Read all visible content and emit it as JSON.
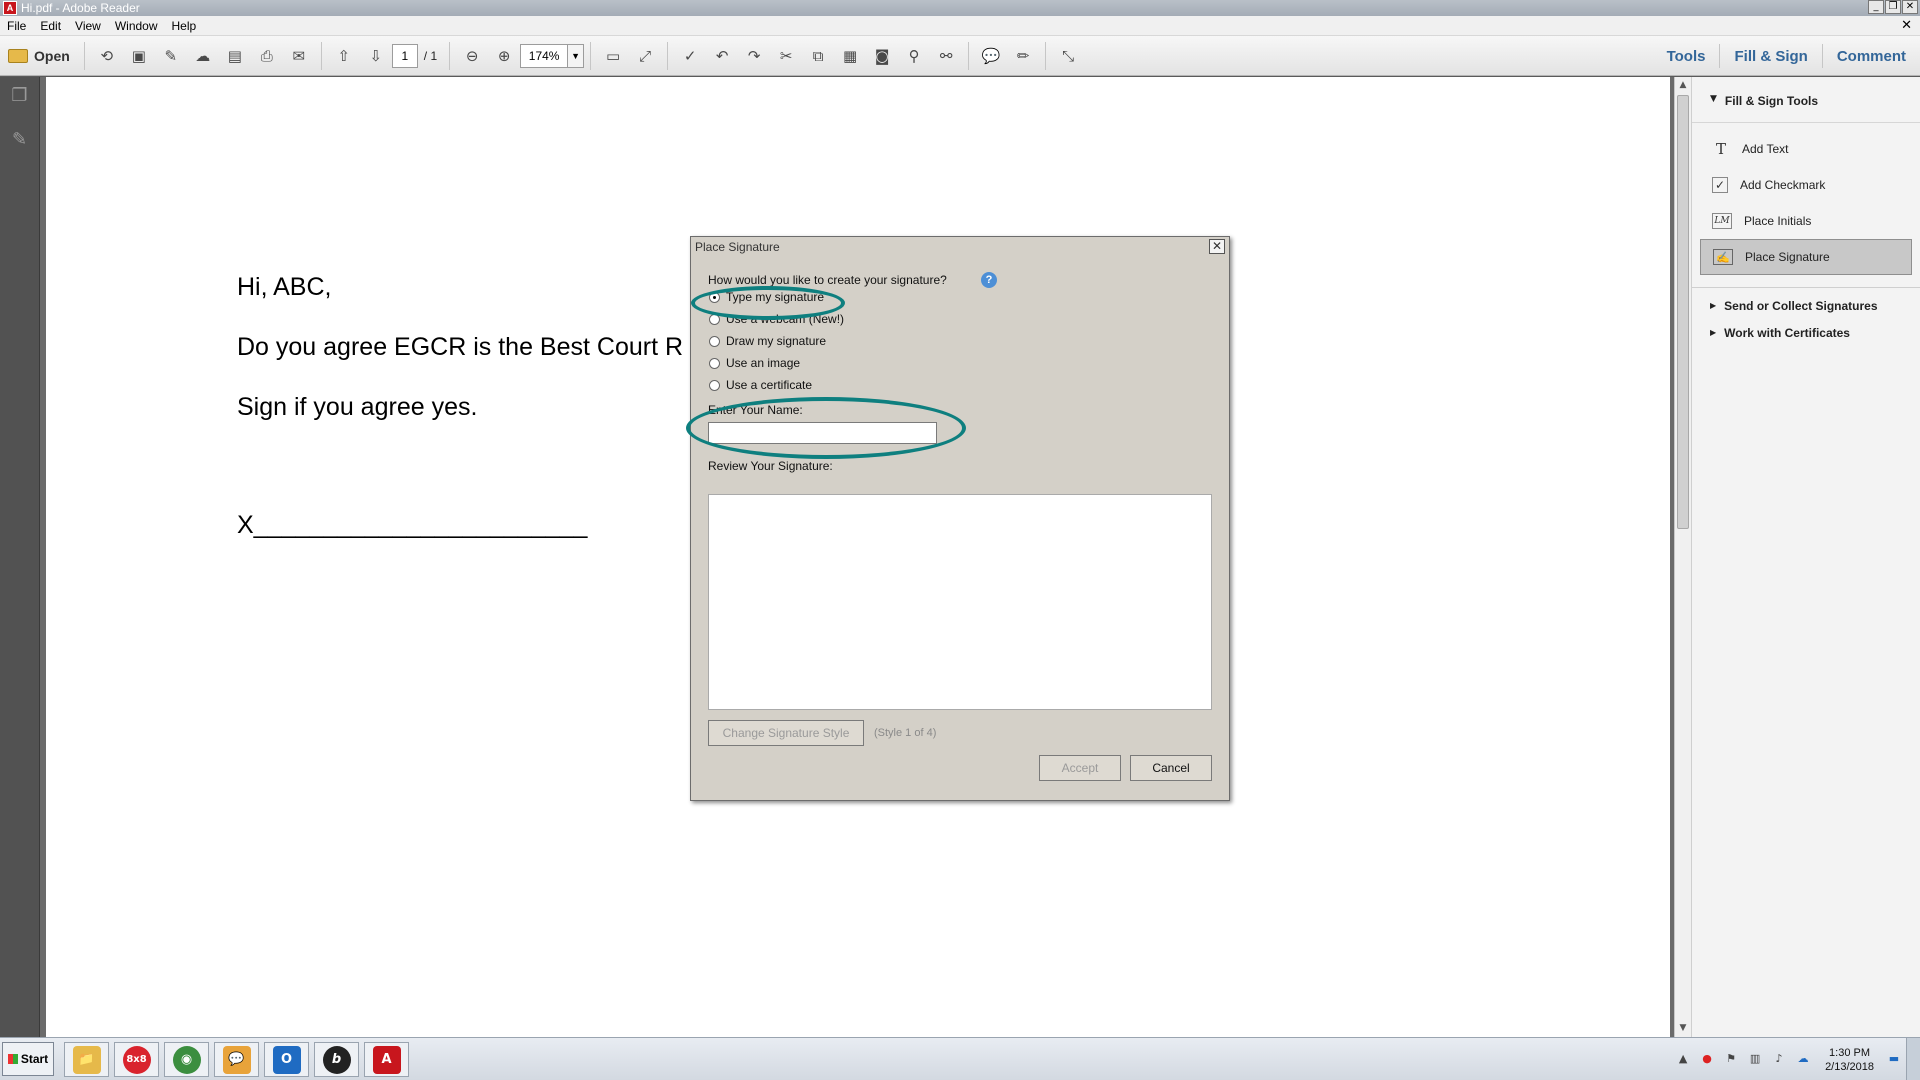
{
  "window": {
    "title": "Hi.pdf - Adobe Reader",
    "app_icon_text": "A",
    "controls": {
      "minimize": "_",
      "restore": "❐",
      "close": "✕"
    },
    "doc_close": "✕"
  },
  "menu": [
    "File",
    "Edit",
    "View",
    "Window",
    "Help"
  ],
  "toolbar": {
    "open_label": "Open",
    "page_current": "1",
    "page_total": "/ 1",
    "zoom": "174%",
    "zoom_dropdown": "▼",
    "tabs": [
      "Tools",
      "Fill & Sign",
      "Comment"
    ],
    "accent_color": "#336699"
  },
  "document": {
    "lines": [
      "Hi, ABC,",
      "Do you agree EGCR is the Best Court R",
      "Sign if you agree yes.",
      "X________________________"
    ]
  },
  "right_panel": {
    "header": "Fill & Sign Tools",
    "header_arrow": "▼",
    "items": [
      {
        "label": "Add Text",
        "icon": "T"
      },
      {
        "label": "Add Checkmark",
        "icon": "✓"
      },
      {
        "label": "Place Initials",
        "icon": "LM"
      },
      {
        "label": "Place Signature",
        "icon": "✍",
        "selected": true
      }
    ],
    "sections": [
      {
        "label": "Send or Collect Signatures",
        "arrow": "▶"
      },
      {
        "label": "Work with Certificates",
        "arrow": "▶"
      }
    ]
  },
  "dialog": {
    "title": "Place Signature",
    "close": "✕",
    "question": "How would you like to create your signature?",
    "help": "?",
    "options": [
      {
        "label": "Type my signature",
        "checked": true
      },
      {
        "label": "Use a webcam (New!)",
        "checked": false
      },
      {
        "label": "Draw my signature",
        "checked": false
      },
      {
        "label": "Use an image",
        "checked": false
      },
      {
        "label": "Use a certificate",
        "checked": false
      }
    ],
    "name_label": "Enter Your Name:",
    "name_value": "",
    "review_label": "Review Your Signature:",
    "change_style_label": "Change Signature Style",
    "style_info": "(Style 1 of 4)",
    "accept_label": "Accept",
    "cancel_label": "Cancel",
    "annotation_color": "#0e7f7f"
  },
  "taskbar": {
    "start_label": "Start",
    "apps": [
      {
        "name": "file-explorer",
        "glyph": "📁",
        "color": "#e6b94a"
      },
      {
        "name": "8x8",
        "glyph": "8x8",
        "color": "#d9232d"
      },
      {
        "name": "chrome",
        "glyph": "◉",
        "color": "#3b8e3f"
      },
      {
        "name": "messenger",
        "glyph": "💬",
        "color": "#e8a33a"
      },
      {
        "name": "outlook",
        "glyph": "O",
        "color": "#1f6bc2"
      },
      {
        "name": "app-b",
        "glyph": "b",
        "color": "#222222"
      },
      {
        "name": "acrobat",
        "glyph": "A",
        "color": "#c8161d"
      }
    ],
    "tray_expand": "▲",
    "time": "1:30 PM",
    "date": "2/13/2018"
  }
}
